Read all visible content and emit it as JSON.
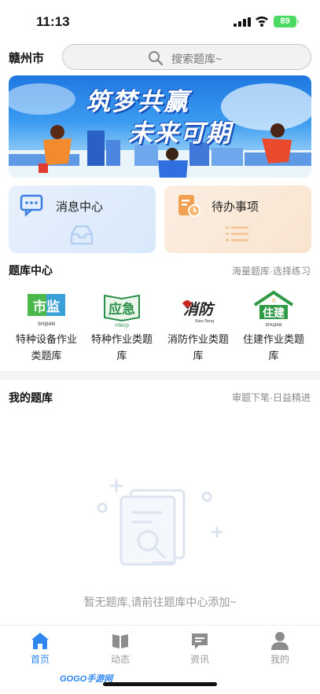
{
  "status": {
    "time": "11:13",
    "battery": "89"
  },
  "header": {
    "city": "赣州市",
    "search_placeholder": "搜索题库~"
  },
  "banner": {
    "line1": "筑梦共赢",
    "line2": "未来可期"
  },
  "quick": {
    "message_center": "消息中心",
    "todo": "待办事项"
  },
  "bank_center": {
    "title": "题库中心",
    "subtitle": "海量题库·选择练习",
    "items": [
      {
        "name": "特种设备作业类题库",
        "logo_text": "市监",
        "logo_caption": "SHIJIAN",
        "color": "#3a9b3a"
      },
      {
        "name": "特种作业类题库",
        "logo_text": "应急",
        "logo_caption": "YINGJI",
        "color": "#2c8f4a"
      },
      {
        "name": "消防作业类题库",
        "logo_text": "消防",
        "logo_caption": "Xiao Fang",
        "color": "#c6271e"
      },
      {
        "name": "住建作业类题库",
        "logo_text": "住建",
        "logo_caption": "ZHUJIAN",
        "color": "#2f9a46"
      }
    ]
  },
  "my_bank": {
    "title": "我的题库",
    "subtitle": "审题下笔·日益精进",
    "empty_text": "暂无题库,请前往题库中心添加~"
  },
  "tabs": [
    {
      "label": "首页",
      "icon": "home-icon",
      "active": true
    },
    {
      "label": "动态",
      "icon": "book-icon",
      "active": false
    },
    {
      "label": "资讯",
      "icon": "news-icon",
      "active": false
    },
    {
      "label": "我的",
      "icon": "user-icon",
      "active": false
    }
  ],
  "watermark": "GOGO手游网",
  "colors": {
    "accent": "#2f86f0",
    "message_card": "#e1edfb",
    "todo_card": "#fae9d7"
  }
}
